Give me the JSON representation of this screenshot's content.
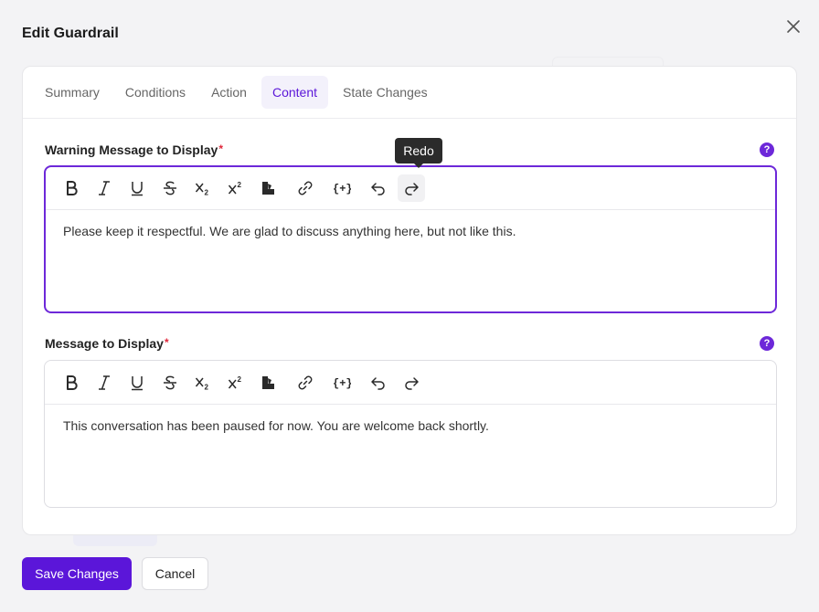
{
  "modal": {
    "title": "Edit Guardrail",
    "close_icon": "close-icon"
  },
  "tabs": [
    {
      "label": "Summary",
      "active": false
    },
    {
      "label": "Conditions",
      "active": false
    },
    {
      "label": "Action",
      "active": false
    },
    {
      "label": "Content",
      "active": true
    },
    {
      "label": "State Changes",
      "active": false
    }
  ],
  "fields": {
    "warning": {
      "label": "Warning Message to Display",
      "required_mark": "*",
      "help_icon": "?",
      "content": "Please keep it respectful. We are glad to discuss anything here, but not like this."
    },
    "message": {
      "label": "Message to Display",
      "required_mark": "*",
      "help_icon": "?",
      "content": "This conversation has been paused for now. You are welcome back shortly."
    }
  },
  "toolbar_icons": [
    "bold-icon",
    "italic-icon",
    "underline-icon",
    "strikethrough-icon",
    "subscript-icon",
    "superscript-icon",
    "highlight-icon",
    "link-icon",
    "variable-icon",
    "undo-icon",
    "redo-icon"
  ],
  "tooltip": {
    "label": "Redo"
  },
  "footer": {
    "save_label": "Save Changes",
    "cancel_label": "Cancel"
  },
  "colors": {
    "accent": "#5b16d9",
    "focus_border": "#6d28d9",
    "required": "#e0273a"
  }
}
